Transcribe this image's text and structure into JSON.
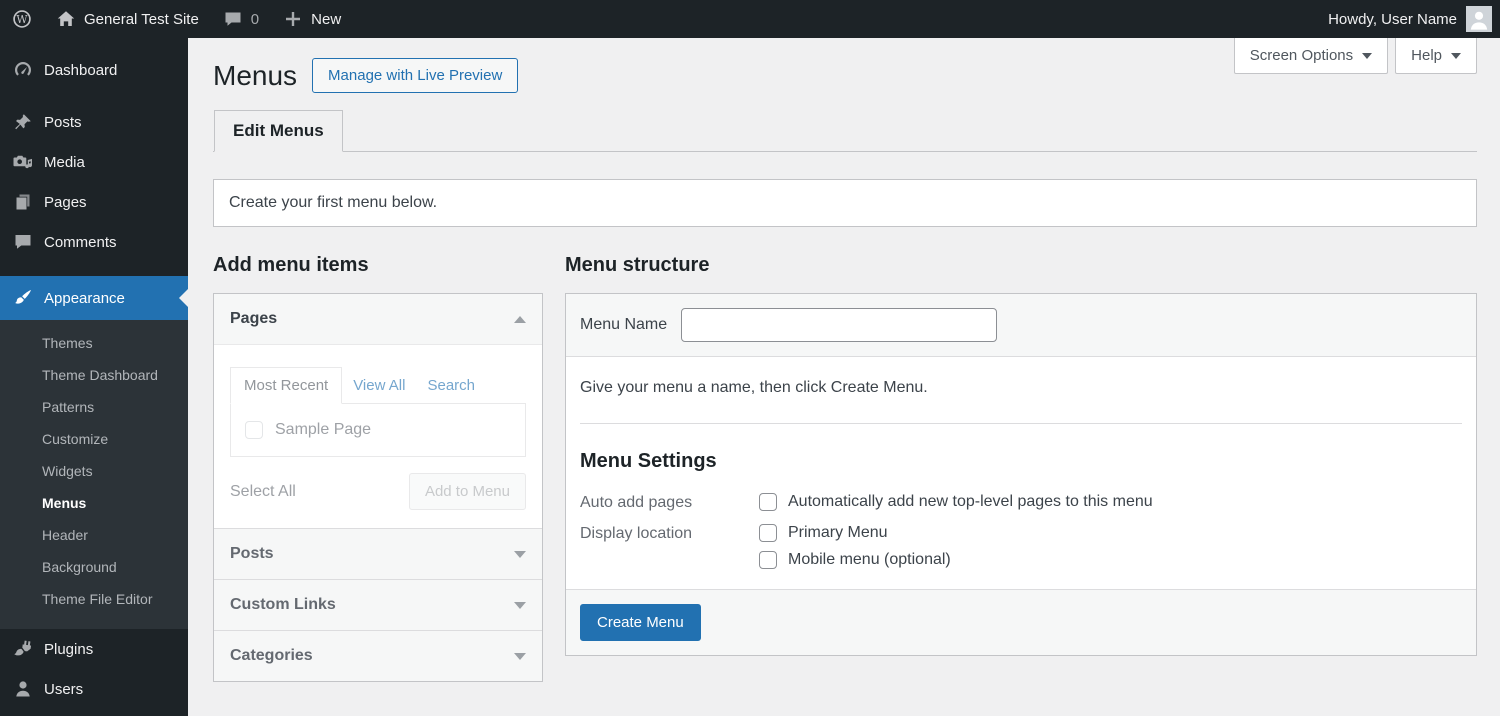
{
  "admin_bar": {
    "site_name": "General Test Site",
    "comments_count": "0",
    "new_label": "New",
    "howdy_text": "Howdy, User Name"
  },
  "sidebar": {
    "items": [
      {
        "label": "Dashboard",
        "icon": "dashboard-gauge-icon"
      },
      {
        "label": "Posts",
        "icon": "pushpin-icon"
      },
      {
        "label": "Media",
        "icon": "media-camera-icon"
      },
      {
        "label": "Pages",
        "icon": "pages-icon"
      },
      {
        "label": "Comments",
        "icon": "comment-bubble-icon"
      },
      {
        "label": "Appearance",
        "icon": "paintbrush-icon",
        "active": true
      },
      {
        "label": "Plugins",
        "icon": "plugin-icon"
      },
      {
        "label": "Users",
        "icon": "user-icon"
      }
    ],
    "appearance_submenu": {
      "items": [
        "Themes",
        "Theme Dashboard",
        "Patterns",
        "Customize",
        "Widgets",
        "Menus",
        "Header",
        "Background",
        "Theme File Editor"
      ],
      "current": "Menus"
    }
  },
  "page": {
    "title": "Menus",
    "action_button": "Manage with Live Preview",
    "screen_options_label": "Screen Options",
    "help_label": "Help",
    "active_tab": "Edit Menus",
    "notice": "Create your first menu below."
  },
  "add_menu_items": {
    "heading": "Add menu items",
    "pages_panel": {
      "title": "Pages",
      "tabs": [
        "Most Recent",
        "View All",
        "Search"
      ],
      "active_tab": "Most Recent",
      "items": [
        {
          "label": "Sample Page",
          "checked": false
        }
      ],
      "select_all_label": "Select All",
      "add_to_menu_label": "Add to Menu"
    },
    "collapsed_panels": [
      "Posts",
      "Custom Links",
      "Categories"
    ]
  },
  "menu_structure": {
    "heading": "Menu structure",
    "menu_name_label": "Menu Name",
    "menu_name_value": "",
    "instruction": "Give your menu a name, then click Create Menu.",
    "menu_settings": {
      "heading": "Menu Settings",
      "rows": [
        {
          "label": "Auto add pages",
          "options": [
            {
              "label": "Automatically add new top-level pages to this menu",
              "checked": false
            }
          ]
        },
        {
          "label": "Display location",
          "options": [
            {
              "label": "Primary Menu",
              "checked": false
            },
            {
              "label": "Mobile menu (optional)",
              "checked": false
            }
          ]
        }
      ]
    },
    "create_button_label": "Create Menu"
  },
  "colors": {
    "accent_blue": "#2271b1",
    "admin_bar_bg": "#1d2327",
    "sidebar_bg": "#1d2327",
    "submenu_bg": "#2c3338",
    "page_bg": "#f0f0f1",
    "card_border": "#c3c4c7"
  }
}
